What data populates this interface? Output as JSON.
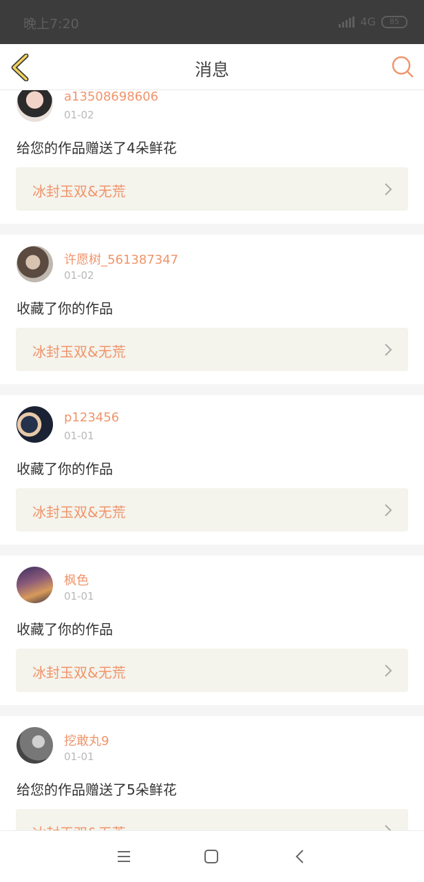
{
  "status_bar": {
    "time": "晚上7:20",
    "network": "4G",
    "battery": "85"
  },
  "header": {
    "title": "消息",
    "back_icon": "chevron-left-icon",
    "search_icon": "search-icon"
  },
  "colors": {
    "accent": "#f0946a",
    "work_bg": "#f4f3ec"
  },
  "messages": [
    {
      "user": "a13508698606",
      "date": "01-02",
      "action": "给您的作品赠送了4朵鲜花",
      "work": "冰封玉双&无荒"
    },
    {
      "user": "许愿树_561387347",
      "date": "01-02",
      "action": "收藏了你的作品",
      "work": "冰封玉双&无荒"
    },
    {
      "user": "p123456",
      "date": "01-01",
      "action": "收藏了你的作品",
      "work": "冰封玉双&无荒"
    },
    {
      "user": "枫色",
      "date": "01-01",
      "action": "收藏了你的作品",
      "work": "冰封玉双&无荒"
    },
    {
      "user": "挖敢丸9",
      "date": "01-01",
      "action": "给您的作品赠送了5朵鲜花",
      "work": "冰封玉双&无荒"
    }
  ],
  "system_nav": {
    "menu_icon": "menu-icon",
    "home_icon": "home-square-icon",
    "back_icon": "back-icon"
  }
}
